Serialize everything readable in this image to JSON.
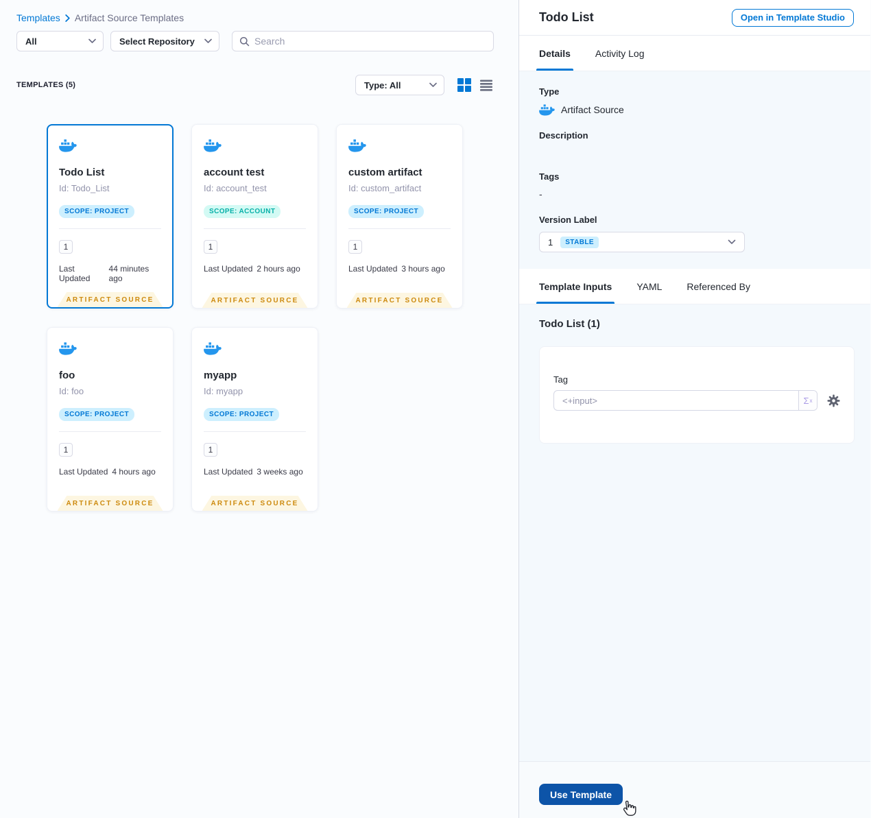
{
  "colors": {
    "primary_blue": "#0278d5",
    "docker_blue": "#2496ed",
    "scope_project_bg": "#cdeffe",
    "scope_account_text": "#07b0a8",
    "scope_account_bg": "#d3faf4",
    "ribbon_text": "#cd8a0e",
    "ribbon_bg": "#fdf6e1",
    "use_template_bg": "#0d54a8",
    "panel_bg": "#f4f9fd"
  },
  "icons": {
    "breadcrumb_separator": "chevron-right",
    "search": "magnifier",
    "dropdown": "chevron-down",
    "view_grid": "grid-squares",
    "view_list": "list-lines",
    "template_type": "docker-whale",
    "expression": "sigma-x",
    "settings": "gear",
    "pointer": "hand-cursor"
  },
  "breadcrumb": {
    "root": "Templates",
    "current": "Artifact Source Templates"
  },
  "filters": {
    "scope_value": "All",
    "repository_value": "Select Repository",
    "search_placeholder": "Search"
  },
  "list_header": {
    "count_label": "TEMPLATES (5)",
    "type_filter_value": "Type: All"
  },
  "card_labels": {
    "updated": "Last Updated"
  },
  "templates": [
    {
      "name": "Todo List",
      "id": "Id: Todo_List",
      "scope": "SCOPE: PROJECT",
      "scope_type": "project",
      "version": "1",
      "updated": "44 minutes ago",
      "ribbon": "ARTIFACT SOURCE",
      "selected": true
    },
    {
      "name": "account test",
      "id": "Id: account_test",
      "scope": "SCOPE: ACCOUNT",
      "scope_type": "account",
      "version": "1",
      "updated": "2 hours ago",
      "ribbon": "ARTIFACT SOURCE",
      "selected": false
    },
    {
      "name": "custom artifact",
      "id": "Id: custom_artifact",
      "scope": "SCOPE: PROJECT",
      "scope_type": "project",
      "version": "1",
      "updated": "3 hours ago",
      "ribbon": "ARTIFACT SOURCE",
      "selected": false
    },
    {
      "name": "foo",
      "id": "Id: foo",
      "scope": "SCOPE: PROJECT",
      "scope_type": "project",
      "version": "1",
      "updated": "4 hours ago",
      "ribbon": "ARTIFACT SOURCE",
      "selected": false
    },
    {
      "name": "myapp",
      "id": "Id: myapp",
      "scope": "SCOPE: PROJECT",
      "scope_type": "project",
      "version": "1",
      "updated": "3 weeks ago",
      "ribbon": "ARTIFACT SOURCE",
      "selected": false
    }
  ],
  "details_panel": {
    "title": "Todo List",
    "open_studio_button": "Open in Template Studio",
    "tabs": [
      "Details",
      "Activity Log"
    ],
    "type_label": "Type",
    "type_value": "Artifact Source",
    "description_label": "Description",
    "tags_label": "Tags",
    "tags_value": "-",
    "version_label": "Version Label",
    "version_value": "1",
    "version_badge": "STABLE",
    "inputs_tabs": [
      "Template Inputs",
      "YAML",
      "Referenced By"
    ],
    "inputs_heading": "Todo List (1)",
    "tag_field_label": "Tag",
    "tag_field_value": "<+input>",
    "expression_glyph": "Σ",
    "use_template_button": "Use Template"
  }
}
